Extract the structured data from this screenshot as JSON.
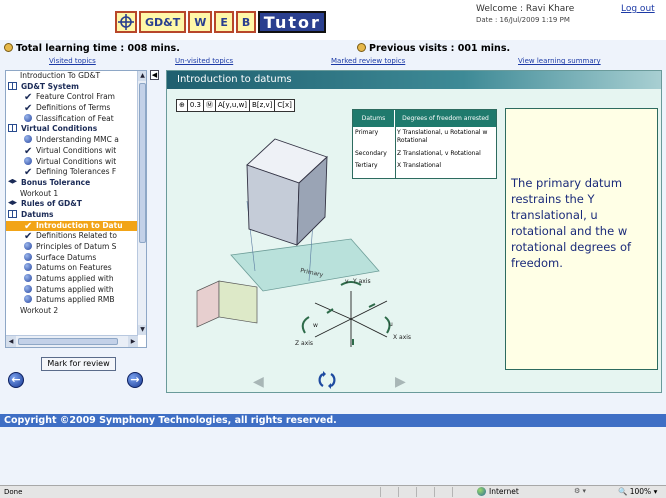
{
  "header": {
    "logo_letters": [
      "GD&T",
      "W",
      "E",
      "B",
      "Tutor"
    ],
    "welcome": "Welcome : Ravi Khare",
    "date": "Date : 16/Jul/2009 1:19 PM",
    "logout": "Log out"
  },
  "stats": {
    "total_time": "Total learning time : 008 mins.",
    "visits": "Previous visits : 001 mins."
  },
  "toplinks": [
    "Visited topics",
    "Un-visited topics",
    "Marked review topics",
    "View learning summary"
  ],
  "sidebar": {
    "items": [
      {
        "label": "Introduction To GD&T",
        "icon": "none",
        "level": 0,
        "type": "item"
      },
      {
        "label": "GD&T System",
        "icon": "book-icon",
        "level": 0,
        "type": "sec"
      },
      {
        "label": "Feature Control Fram",
        "icon": "check-icon",
        "level": 1,
        "type": "item"
      },
      {
        "label": "Definitions of Terms",
        "icon": "check-icon",
        "level": 1,
        "type": "item"
      },
      {
        "label": "Classification of Feat",
        "icon": "dot-icon",
        "level": 1,
        "type": "item"
      },
      {
        "label": "Virtual Conditions",
        "icon": "book-icon",
        "level": 0,
        "type": "sec"
      },
      {
        "label": "Understanding MMC a",
        "icon": "dot-icon",
        "level": 1,
        "type": "item"
      },
      {
        "label": "Virtual Conditions wit",
        "icon": "check-icon",
        "level": 1,
        "type": "item"
      },
      {
        "label": "Virtual Conditions wit",
        "icon": "dot-icon",
        "level": 1,
        "type": "item"
      },
      {
        "label": "Defining Tolerances F",
        "icon": "check-icon",
        "level": 1,
        "type": "item"
      },
      {
        "label": "Bonus Tolerance",
        "icon": "cap-icon",
        "level": 0,
        "type": "sec"
      },
      {
        "label": "Workout 1",
        "icon": "none",
        "level": 1,
        "type": "item"
      },
      {
        "label": "Rules of GD&T",
        "icon": "cap-icon",
        "level": 0,
        "type": "sec"
      },
      {
        "label": "Datums",
        "icon": "book-icon",
        "level": 0,
        "type": "sec"
      },
      {
        "label": "Introduction to Datu",
        "icon": "check-icon",
        "level": 1,
        "type": "active"
      },
      {
        "label": "Definitions Related to",
        "icon": "check-icon",
        "level": 1,
        "type": "item"
      },
      {
        "label": "Principles of Datum S",
        "icon": "dot-icon",
        "level": 1,
        "type": "item"
      },
      {
        "label": "Surface Datums",
        "icon": "dot-icon",
        "level": 1,
        "type": "item"
      },
      {
        "label": "Datums on Features",
        "icon": "dot-icon",
        "level": 1,
        "type": "item"
      },
      {
        "label": "Datums applied with",
        "icon": "dot-icon",
        "level": 1,
        "type": "item"
      },
      {
        "label": "Datums applied with",
        "icon": "dot-icon",
        "level": 1,
        "type": "item"
      },
      {
        "label": "Datums applied RMB",
        "icon": "dot-icon",
        "level": 1,
        "type": "item"
      },
      {
        "label": "Workout 2",
        "icon": "none",
        "level": 1,
        "type": "item"
      }
    ],
    "mark_review": "Mark for review"
  },
  "content": {
    "title": "Introduction to datums",
    "fcf": [
      "⊕",
      "0.3",
      "Ⓜ",
      "A[y,u,w]",
      "B[z,v]",
      "C[x]"
    ],
    "table": {
      "headers": [
        "Datums",
        "Degrees of freedom arrested"
      ],
      "rows": [
        [
          "Primary",
          "Y Translational, u Rotational w Rotational"
        ],
        [
          "Secondary",
          "Z Translational, v Rotational"
        ],
        [
          "Tertiary",
          "X Translational"
        ]
      ]
    },
    "explanation": "The primary datum restrains the Y translational, u rotational and the w rotational degrees of freedom.",
    "diagram_labels": {
      "primary": "Primary",
      "y_axis": "Y axis",
      "v": "v",
      "u": "u",
      "w": "w",
      "z_axis": "Z axis",
      "x_axis": "X axis"
    }
  },
  "footer": {
    "copyright": "Copyright ©2009 Symphony Technologies, all rights reserved.",
    "status": "Done",
    "zone": "Internet",
    "zoom": "100%"
  },
  "colors": {
    "accent": "#3f6fc5",
    "active_item": "#f2a417",
    "content_bg": "#e6f5f1",
    "title_bar": "#1f5f6f",
    "explanation_text": "#1b2b7a"
  }
}
